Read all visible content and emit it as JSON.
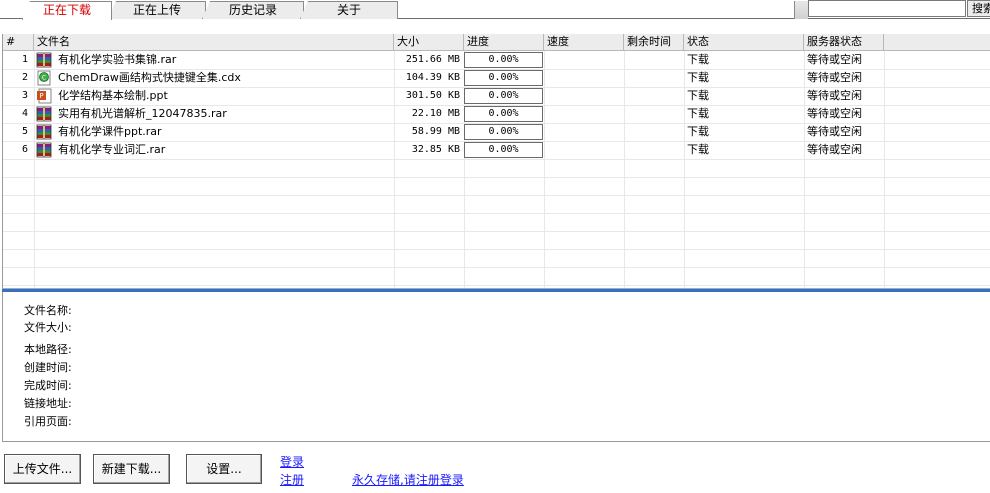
{
  "tabs": [
    {
      "label": "正在下载",
      "active": true
    },
    {
      "label": "正在上传",
      "active": false
    },
    {
      "label": "历史记录",
      "active": false
    },
    {
      "label": "关于",
      "active": false
    }
  ],
  "search": {
    "value": "",
    "button_label": "搜索"
  },
  "columns": [
    "#",
    "文件名",
    "大小",
    "进度",
    "速度",
    "剩余时间",
    "状态",
    "服务器状态"
  ],
  "files": [
    {
      "index": "1",
      "name": "有机化学实验书集锦.rar",
      "size": "251.66 MB",
      "progress": "0.00%",
      "speed": "",
      "remaining": "",
      "status": "下载",
      "server_status": "等待或空闲",
      "icon": "rar-archive-icon"
    },
    {
      "index": "2",
      "name": "ChemDraw画结构式快捷键全集.cdx",
      "size": "104.39 KB",
      "progress": "0.00%",
      "speed": "",
      "remaining": "",
      "status": "下载",
      "server_status": "等待或空闲",
      "icon": "chemdraw-file-icon"
    },
    {
      "index": "3",
      "name": "化学结构基本绘制.ppt",
      "size": "301.50 KB",
      "progress": "0.00%",
      "speed": "",
      "remaining": "",
      "status": "下载",
      "server_status": "等待或空闲",
      "icon": "powerpoint-file-icon"
    },
    {
      "index": "4",
      "name": "实用有机光谱解析_12047835.rar",
      "size": "22.10 MB",
      "progress": "0.00%",
      "speed": "",
      "remaining": "",
      "status": "下载",
      "server_status": "等待或空闲",
      "icon": "rar-archive-icon"
    },
    {
      "index": "5",
      "name": "有机化学课件ppt.rar",
      "size": "58.99 MB",
      "progress": "0.00%",
      "speed": "",
      "remaining": "",
      "status": "下载",
      "server_status": "等待或空闲",
      "icon": "rar-archive-icon"
    },
    {
      "index": "6",
      "name": "有机化学专业词汇.rar",
      "size": "32.85 KB",
      "progress": "0.00%",
      "speed": "",
      "remaining": "",
      "status": "下载",
      "server_status": "等待或空闲",
      "icon": "rar-archive-icon"
    }
  ],
  "details": {
    "file_name_label": "文件名称:",
    "file_size_label": "文件大小:",
    "local_path_label": "本地路径:",
    "created_label": "创建时间:",
    "completed_label": "完成时间:",
    "link_label": "链接地址:",
    "referrer_label": "引用页面:"
  },
  "buttons": {
    "upload": "上传文件...",
    "new_download": "新建下载...",
    "settings": "设置..."
  },
  "links": {
    "login": "登录",
    "register": "注册",
    "permanent_storage": "永久存储,请注册登录"
  },
  "colors": {
    "accent_tab_text": "#d40000",
    "splitter": "#3b6fb6",
    "link": "#1a1aff"
  }
}
